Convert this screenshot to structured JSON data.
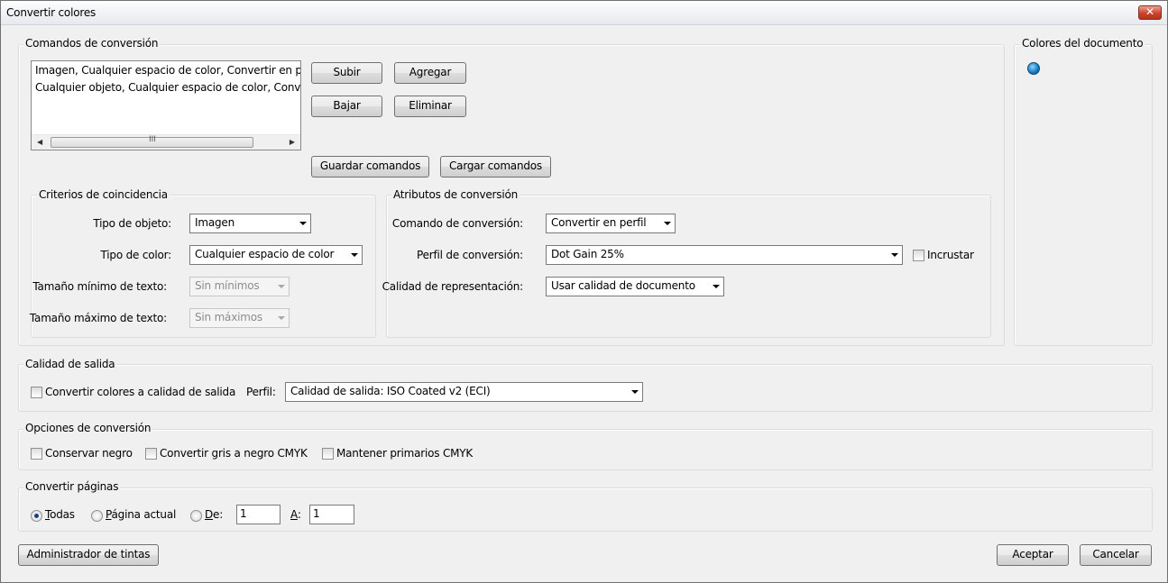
{
  "window": {
    "title": "Convertir colores",
    "close_label": "✕"
  },
  "commands": {
    "group_label": "Comandos de conversión",
    "list": [
      "Imagen, Cualquier espacio de color, Convertir en perfil",
      "Cualquier objeto, Cualquier espacio de color, Convertir"
    ],
    "scroll_grip": "III",
    "up_button": "Subir",
    "add_button": "Agregar",
    "down_button": "Bajar",
    "delete_button": "Eliminar",
    "save_button": "Guardar comandos",
    "load_button": "Cargar comandos"
  },
  "document_colors": {
    "group_label": "Colores del documento",
    "swatch_color": "#1479b8"
  },
  "criteria": {
    "group_label": "Criterios de coincidencia",
    "object_type_label": "Tipo de objeto:",
    "object_type_value": "Imagen",
    "color_type_label": "Tipo de color:",
    "color_type_value": "Cualquier espacio de color",
    "min_text_label": "Tamaño mínimo de texto:",
    "min_text_value": "Sin mínimos",
    "max_text_label": "Tamaño máximo de texto:",
    "max_text_value": "Sin máximos"
  },
  "attributes": {
    "group_label": "Atributos de conversión",
    "command_label": "Comando de conversión:",
    "command_value": "Convertir en perfil",
    "profile_label": "Perfil de conversión:",
    "profile_value": "Dot Gain 25%",
    "embed_label": "Incrustar",
    "embed_checked": false,
    "rendering_label": "Calidad de representación:",
    "rendering_value": "Usar calidad de documento"
  },
  "output": {
    "group_label": "Calidad de salida",
    "convert_label": "Convertir colores a calidad de salida",
    "convert_checked": false,
    "profile_label": "Perfil:",
    "profile_value": "Calidad de salida: ISO Coated v2 (ECI)"
  },
  "options": {
    "group_label": "Opciones de conversión",
    "keep_black": "Conservar negro",
    "gray_to_black": "Convertir gris a negro CMYK",
    "keep_primaries": "Mantener primarios CMYK"
  },
  "pages": {
    "group_label": "Convertir páginas",
    "all_u": "T",
    "all_rest": "odas",
    "current_u": "P",
    "current_rest": "ágina actual",
    "from_u": "D",
    "from_rest": "e:",
    "from_value": "1",
    "to_u": "A",
    "to_rest": ":",
    "to_value": "1",
    "selected": "all"
  },
  "footer": {
    "ink_manager": "Administrador de tintas",
    "ok": "Aceptar",
    "cancel": "Cancelar"
  }
}
